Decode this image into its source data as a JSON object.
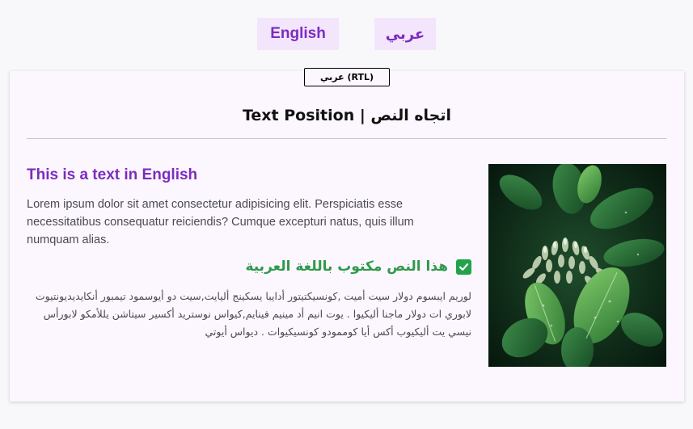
{
  "language_switcher": {
    "english_label": "English",
    "arabic_label": "عربي"
  },
  "card": {
    "direction_badge": "عربي (RTL)",
    "title": "Text Position | اتجاه النص",
    "english": {
      "heading": "This is a text in English",
      "body": "Lorem ipsum dolor sit amet consectetur adipisicing elit. Perspiciatis esse necessitatibus consequatur reiciendis? Cumque excepturi natus, quis illum numquam alias."
    },
    "arabic": {
      "heading": "هذا النص مكتوب باللغة العربية",
      "body": "لوريم ايبسوم دولار سيت أميت ,كونسيكتيتور أدايبا يسكينج أليايت,سيت دو أيوسمود تيمبور أنكايديديونتيوت لابوري ات دولار ماجنا أليكيوا . يوت انيم أد مينيم فينايم,كيواس نوستريد أكسير سيتاشن يللأمكو لابورأس نيسي يت أليكيوب أكس أيا كوممودو كونسيكيوات . ديواس أيوتي"
    },
    "image": {
      "icon": "plant-photo"
    }
  },
  "colors": {
    "accent": "#7b2cbf",
    "button_bg": "#f3e5fc",
    "card_bg": "#fcf6fe",
    "arabic_heading": "#2e9a4a",
    "check": "#22a24b"
  }
}
